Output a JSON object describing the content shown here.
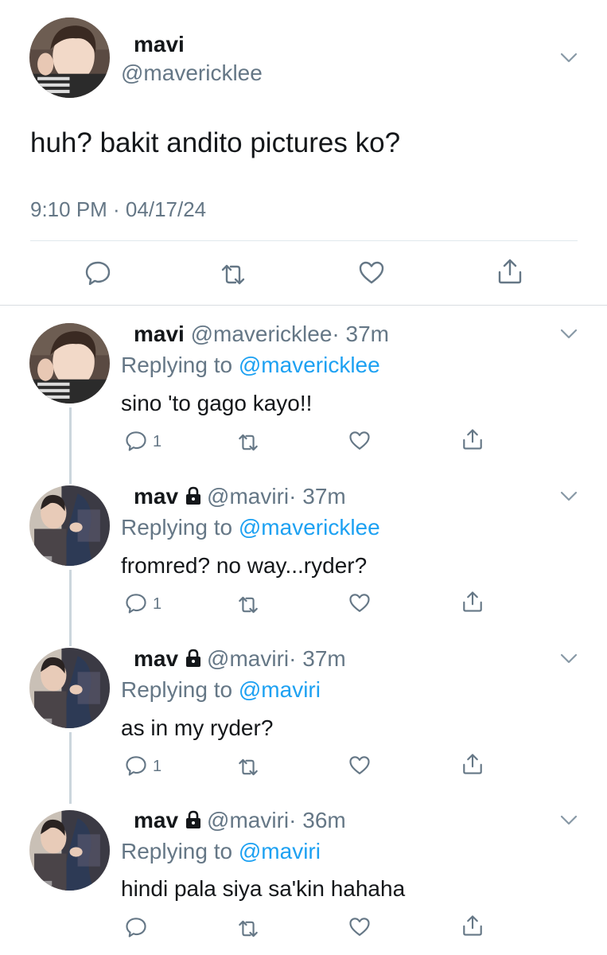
{
  "main_tweet": {
    "name": "mavi",
    "handle": "@mavericklee",
    "text": "huh? bakit andito pictures ko?",
    "timestamp": "9:10 PM · 04/17/24",
    "avatar_icon": "avatar-photo-icon"
  },
  "replies": [
    {
      "name": "mavi",
      "handle": "@mavericklee",
      "time": "· 37m",
      "replying_label": "Replying to ",
      "replying_to": "@mavericklee",
      "text": "sino 'to gago kayo!!",
      "reply_count": "1",
      "locked": false
    },
    {
      "name": "mav",
      "handle": "@maviri",
      "time": "· 37m",
      "replying_label": "Replying to ",
      "replying_to": "@mavericklee",
      "text": "fromred? no way...ryder?",
      "reply_count": "1",
      "locked": true
    },
    {
      "name": "mav",
      "handle": "@maviri",
      "time": "· 37m",
      "replying_label": "Replying to ",
      "replying_to": "@maviri",
      "text": "as in my ryder?",
      "reply_count": "1",
      "locked": true
    },
    {
      "name": "mav",
      "handle": "@maviri",
      "time": "· 36m",
      "replying_label": "Replying to ",
      "replying_to": "@maviri",
      "text": "hindi pala siya sa'kin hahaha",
      "reply_count": "",
      "locked": true
    }
  ],
  "colors": {
    "accent": "#1da1f2",
    "secondary_text": "#657786",
    "primary_text": "#14171a",
    "divider": "#e1e8ed"
  }
}
